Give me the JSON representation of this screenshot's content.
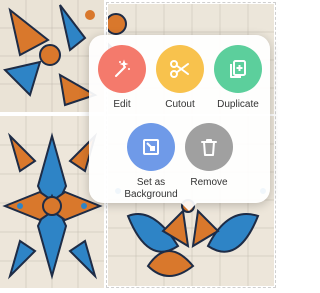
{
  "menu": {
    "actions": [
      {
        "label": "Edit",
        "icon": "magic-wand-icon",
        "color": "#f47a6c"
      },
      {
        "label": "Cutout",
        "icon": "scissors-icon",
        "color": "#f8c24d"
      },
      {
        "label": "Duplicate",
        "icon": "duplicate-icon",
        "color": "#5ccf9c"
      },
      {
        "label": "Set as\nBackground",
        "icon": "set-background-icon",
        "color": "#6f9ae8"
      },
      {
        "label": "Remove",
        "icon": "trash-icon",
        "color": "#a0a0a0"
      }
    ]
  },
  "colors": {
    "tile_cream": "#efe8dc",
    "tile_orange": "#d9782c",
    "tile_blue": "#2e84c6",
    "tile_navy": "#1e2c46"
  }
}
